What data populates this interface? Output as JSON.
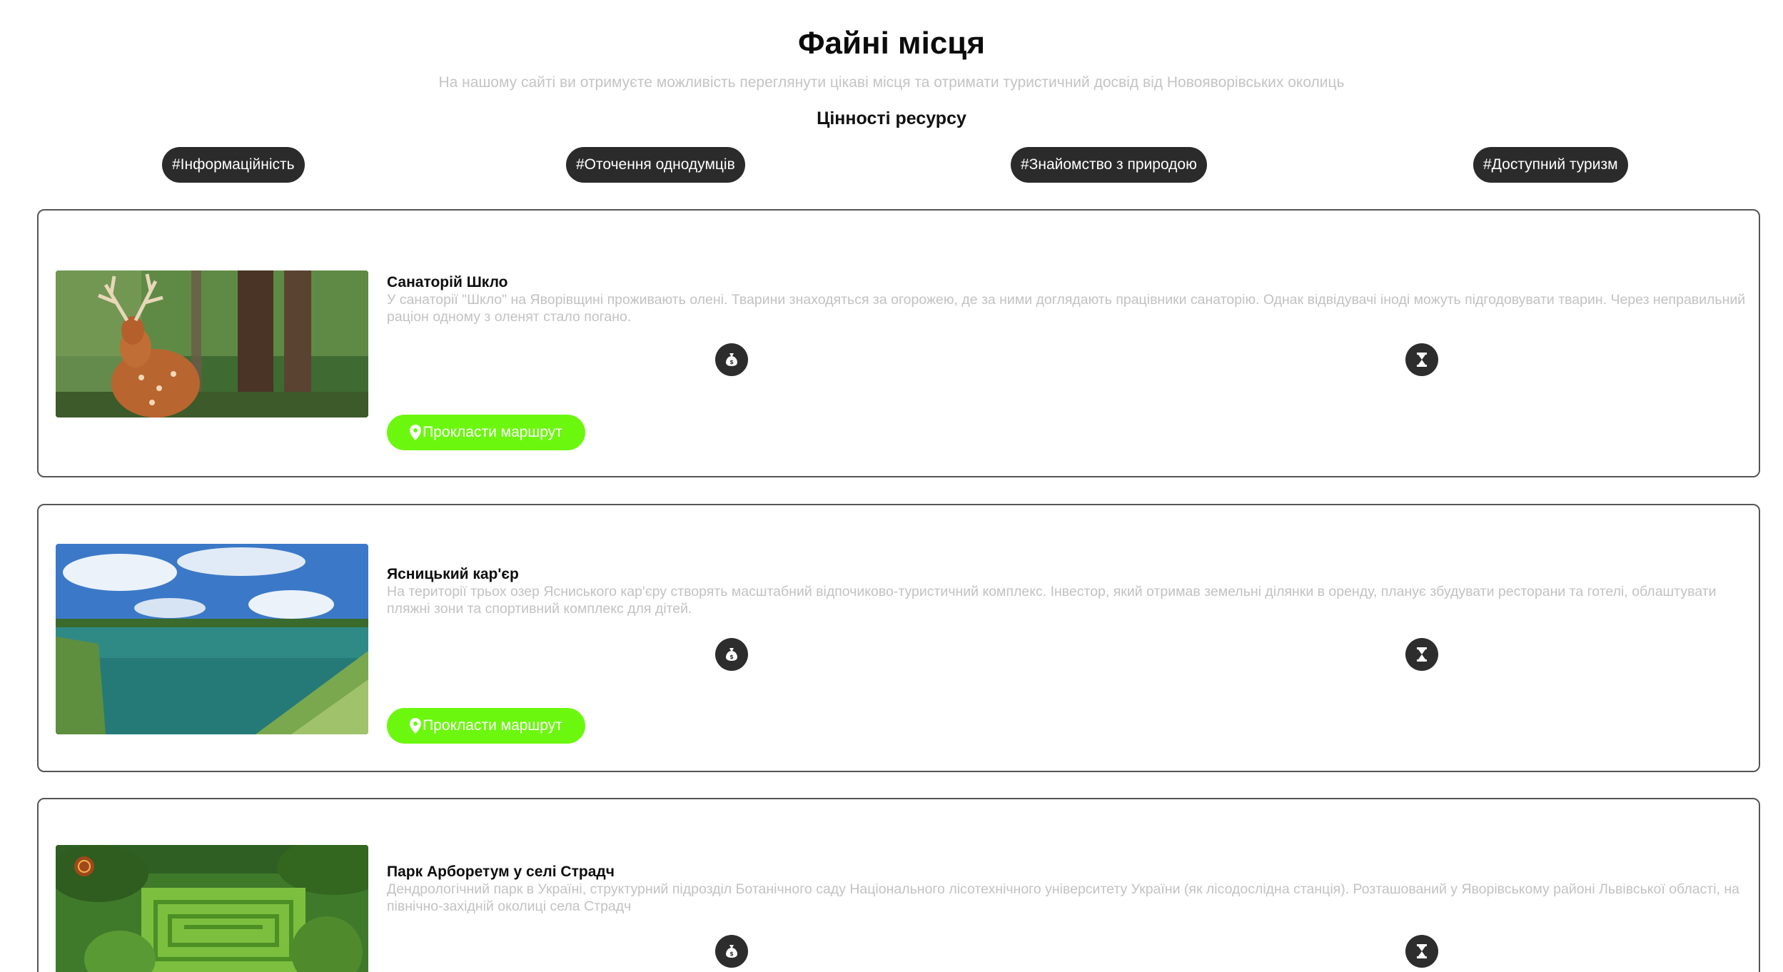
{
  "header": {
    "title": "Файні місця",
    "subtitle": "На нашому сайті ви отримуєте можливість переглянути цікаві місця та отримати туристичний досвід від Новояворівських околиць",
    "values_heading": "Цінності ресурсу"
  },
  "tags": [
    "#Інформаційність",
    "#Оточення однодумців",
    "#Знайомство з природою",
    "#Доступний туризм"
  ],
  "route_label": "Прокласти маршрут",
  "icons": {
    "price": "money-bag-icon",
    "time": "hourglass-icon",
    "route": "map-pin-icon"
  },
  "colors": {
    "accent": "#6cf70f",
    "tag_bg": "#2b2b2b",
    "icon_bg": "#2d2d2d",
    "muted_text": "#c2c2c2"
  },
  "places": [
    {
      "title": "Санаторій Шкло",
      "description": "У санаторії \"Шкло\" на Яворівщині проживають олені. Тварини знаходяться за огорожею, де за ними доглядають працівники санаторію. Однак відвідувачі іноді можуть підгодовувати тварин. Через неправильний раціон одному з оленят стало погано.",
      "image": "deer-photo"
    },
    {
      "title": "Ясницький кар'єр",
      "description": "На території трьох озер Ясниського кар'єру створять масштабний відпочиково-туристичний комплекс. Інвестор, який отримав земельні ділянки в оренду, планує збудувати ресторани та готелі, облаштувати пляжні зони та спортивний комплекс для дітей.",
      "image": "lake-photo"
    },
    {
      "title": "Парк Арборетум у селі Страдч",
      "description": "Дендрологічний парк в Україні, структурний підрозділ Ботанічного саду Національного лісотехнічного університету України (як лісодослідна станція). Розташований у Яворівському районі Львівської області, на північно-західній околиці села Страдч",
      "image": "park-photo"
    }
  ]
}
